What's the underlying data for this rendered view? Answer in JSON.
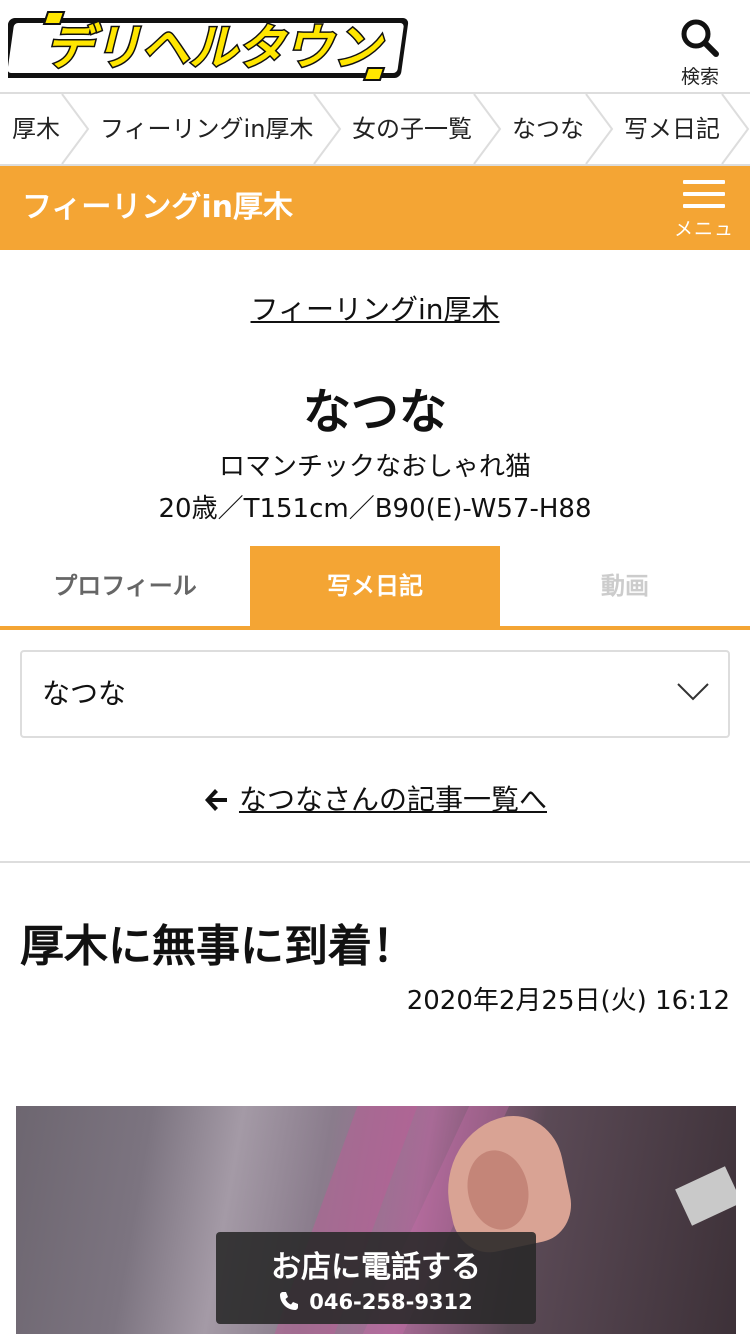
{
  "header": {
    "logo_text": "デリヘルタウン",
    "search_label": "検索"
  },
  "breadcrumb": [
    {
      "label": "厚木"
    },
    {
      "label": "フィーリングin厚木"
    },
    {
      "label": "女の子一覧"
    },
    {
      "label": "なつな"
    },
    {
      "label": "写メ日記"
    }
  ],
  "shopbar": {
    "title": "フィーリングin厚木",
    "menu_label": "メニュー"
  },
  "profile": {
    "shop_link": "フィーリングin厚木",
    "name": "なつな",
    "catchphrase": "ロマンチックなおしゃれ猫",
    "spec": "20歳／T151cm／B90(E)-W57-H88"
  },
  "tabs": {
    "profile": "プロフィール",
    "diary": "写メ日記",
    "movie": "動画"
  },
  "select": {
    "value": "なつな"
  },
  "back_link": "なつなさんの記事一覧へ",
  "article": {
    "title": "厚木に無事に到着！",
    "date": "2020年2月25日(火) 16:12"
  },
  "call": {
    "label": "お店に電話する",
    "number": "046-258-9312"
  },
  "colors": {
    "accent": "#f4a534",
    "logo_yellow": "#ffe600",
    "logo_outline": "#111111"
  },
  "icons": {
    "search": "search-icon",
    "menu": "hamburger-icon",
    "chevron": "chevron-down-icon",
    "back": "arrow-left-icon",
    "phone": "phone-icon"
  }
}
